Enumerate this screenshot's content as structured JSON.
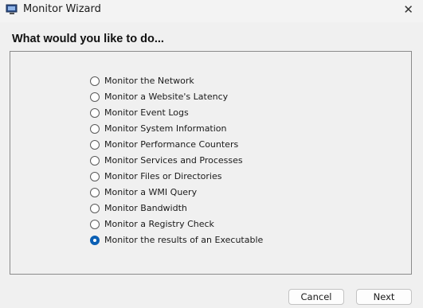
{
  "window": {
    "title": "Monitor Wizard",
    "close_glyph": "✕"
  },
  "heading": "What would you like to do...",
  "options": [
    {
      "label": "Monitor the Network",
      "checked": false
    },
    {
      "label": "Monitor a Website's Latency",
      "checked": false
    },
    {
      "label": "Monitor Event Logs",
      "checked": false
    },
    {
      "label": "Monitor System Information",
      "checked": false
    },
    {
      "label": "Monitor Performance Counters",
      "checked": false
    },
    {
      "label": "Monitor Services and Processes",
      "checked": false
    },
    {
      "label": "Monitor Files or Directories",
      "checked": false
    },
    {
      "label": "Monitor a WMI Query",
      "checked": false
    },
    {
      "label": "Monitor Bandwidth",
      "checked": false
    },
    {
      "label": "Monitor a Registry Check",
      "checked": false
    },
    {
      "label": "Monitor the results of an Executable",
      "checked": true
    }
  ],
  "buttons": {
    "cancel": "Cancel",
    "next": "Next"
  },
  "icons": {
    "app": "monitor-app-icon",
    "close": "close-icon"
  },
  "colors": {
    "accent": "#0a5fb4"
  }
}
